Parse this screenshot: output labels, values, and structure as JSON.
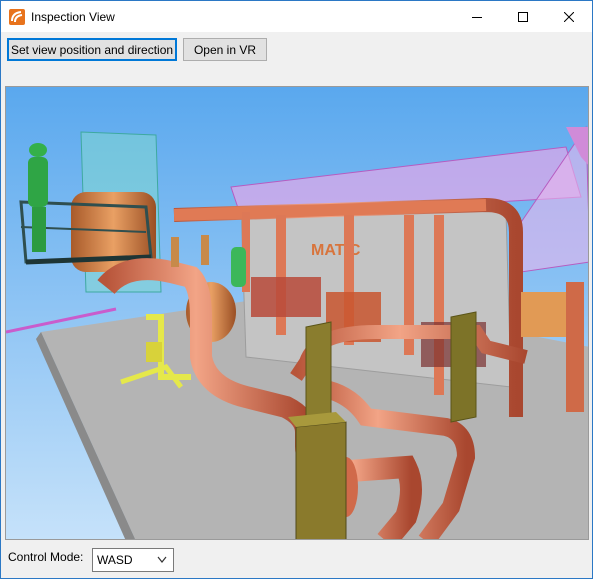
{
  "window": {
    "title": "Inspection View",
    "app_icon": "app-logo-icon"
  },
  "titlebar_controls": [
    "minimize-icon",
    "maximize-icon",
    "close-icon"
  ],
  "toolbar": {
    "set_view_label": "Set view position and direction",
    "open_vr_label": "Open in VR"
  },
  "viewport": {
    "signage_text": "MATIC",
    "sky_color": "#8ec4f0",
    "floor_color": "#b8b8b8",
    "pipe_color": "#e07a55",
    "wall_color": "#c9c9c9"
  },
  "footer": {
    "control_mode_label": "Control Mode:",
    "control_mode_value": "WASD"
  }
}
